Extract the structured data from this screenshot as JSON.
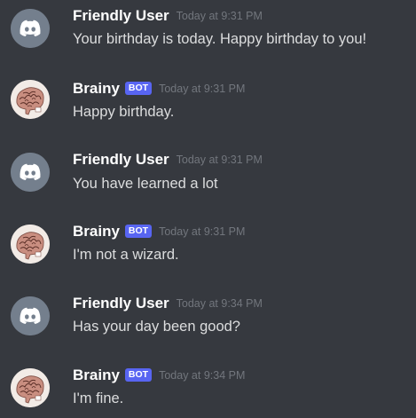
{
  "messages": [
    {
      "username": "Friendly User",
      "timestamp": "Today at 9:31 PM",
      "text": "Your birthday is today. Happy birthday to you!",
      "avatar": "discord-default-icon"
    },
    {
      "username": "Brainy",
      "badge": "BOT",
      "timestamp": "Today at 9:31 PM",
      "text": "Happy birthday.",
      "avatar": "brain-icon"
    },
    {
      "username": "Friendly User",
      "timestamp": "Today at 9:31 PM",
      "text": "You have learned a lot",
      "avatar": "discord-default-icon"
    },
    {
      "username": "Brainy",
      "badge": "BOT",
      "timestamp": "Today at 9:31 PM",
      "text": "I'm not a wizard.",
      "avatar": "brain-icon"
    },
    {
      "username": "Friendly User",
      "timestamp": "Today at 9:34 PM",
      "text": "Has your day been good?",
      "avatar": "discord-default-icon"
    },
    {
      "username": "Brainy",
      "badge": "BOT",
      "timestamp": "Today at 9:34 PM",
      "text": "I'm fine.",
      "avatar": "brain-icon"
    }
  ],
  "colors": {
    "background": "#36393f",
    "username": "#ffffff",
    "message_text": "#dcddde",
    "timestamp": "#72767d",
    "bot_badge": "#5865f2",
    "discord_avatar_bg": "#747f8d"
  }
}
